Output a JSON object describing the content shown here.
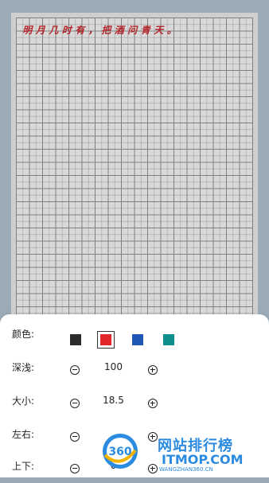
{
  "paper": {
    "verse_chars": [
      "明",
      "月",
      "几",
      "时",
      "有",
      "，",
      "把",
      "酒",
      "问",
      "青",
      "天",
      "。"
    ]
  },
  "settings": {
    "color": {
      "label": "颜色:",
      "swatches": [
        "#2b2b2b",
        "#e3262a",
        "#1f57b6",
        "#0f8f8c"
      ],
      "selected_index": 1
    },
    "depth": {
      "label": "深浅:",
      "value": "100"
    },
    "size": {
      "label": "大小:",
      "value": "18.5"
    },
    "horizontal": {
      "label": "左右:",
      "value": ""
    },
    "vertical": {
      "label": "上下:",
      "value": "0"
    }
  },
  "watermark": {
    "logo_text": "360",
    "cn": "网站排行榜",
    "en": "ITMOP.COM",
    "site": "WANGZHAN360.CN"
  }
}
